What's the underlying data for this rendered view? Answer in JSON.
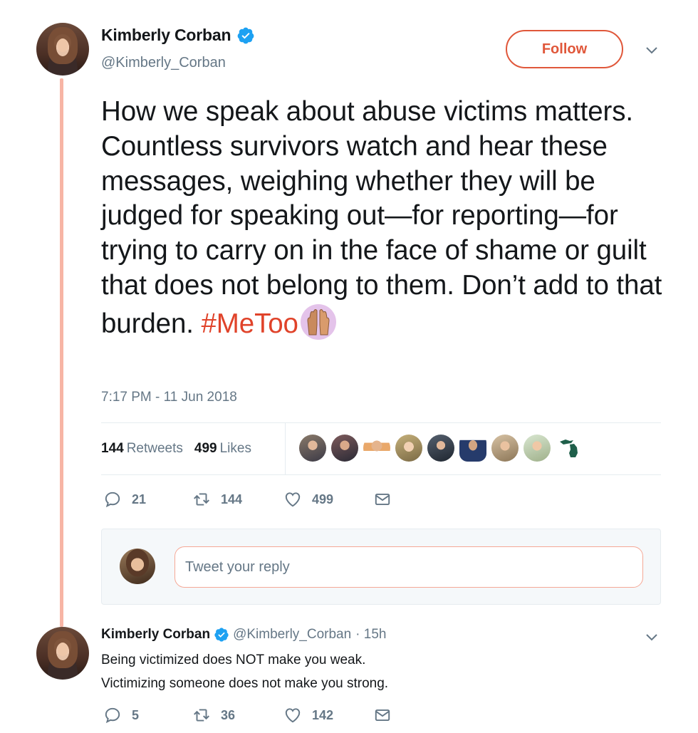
{
  "tweet": {
    "author": {
      "name": "Kimberly Corban",
      "handle": "@Kimberly_Corban"
    },
    "follow_label": "Follow",
    "text_before": "How we speak about abuse victims matters. Countless survivors watch and hear these messages, weighing whether they will be judged for speaking out—for reporting—for trying to carry on in the face of shame or guilt that does not belong to them. Don’t add to that burden. ",
    "hashtag": "#MeToo",
    "emoji_icon": "raised-hands-icon",
    "timestamp": "7:17 PM - 11 Jun 2018",
    "stats": {
      "retweets_count": "144",
      "retweets_label": "Retweets",
      "likes_count": "499",
      "likes_label": "Likes"
    },
    "likers_count": 9,
    "actions": {
      "replies": "21",
      "retweets": "144",
      "likes": "499"
    }
  },
  "reply_composer": {
    "placeholder": "Tweet your reply"
  },
  "reply": {
    "name": "Kimberly Corban",
    "handle": "@Kimberly_Corban",
    "time": "· 15h",
    "line1": "Being victimized does NOT make you weak.",
    "line2": "Victimizing someone does not make you strong.",
    "actions": {
      "replies": "5",
      "retweets": "36",
      "likes": "142"
    }
  },
  "colors": {
    "accent": "#e0573a",
    "hashtag": "#e0432a",
    "verified": "#1da1f2",
    "thread_line": "#f7b5a5",
    "muted_text": "#657786"
  }
}
